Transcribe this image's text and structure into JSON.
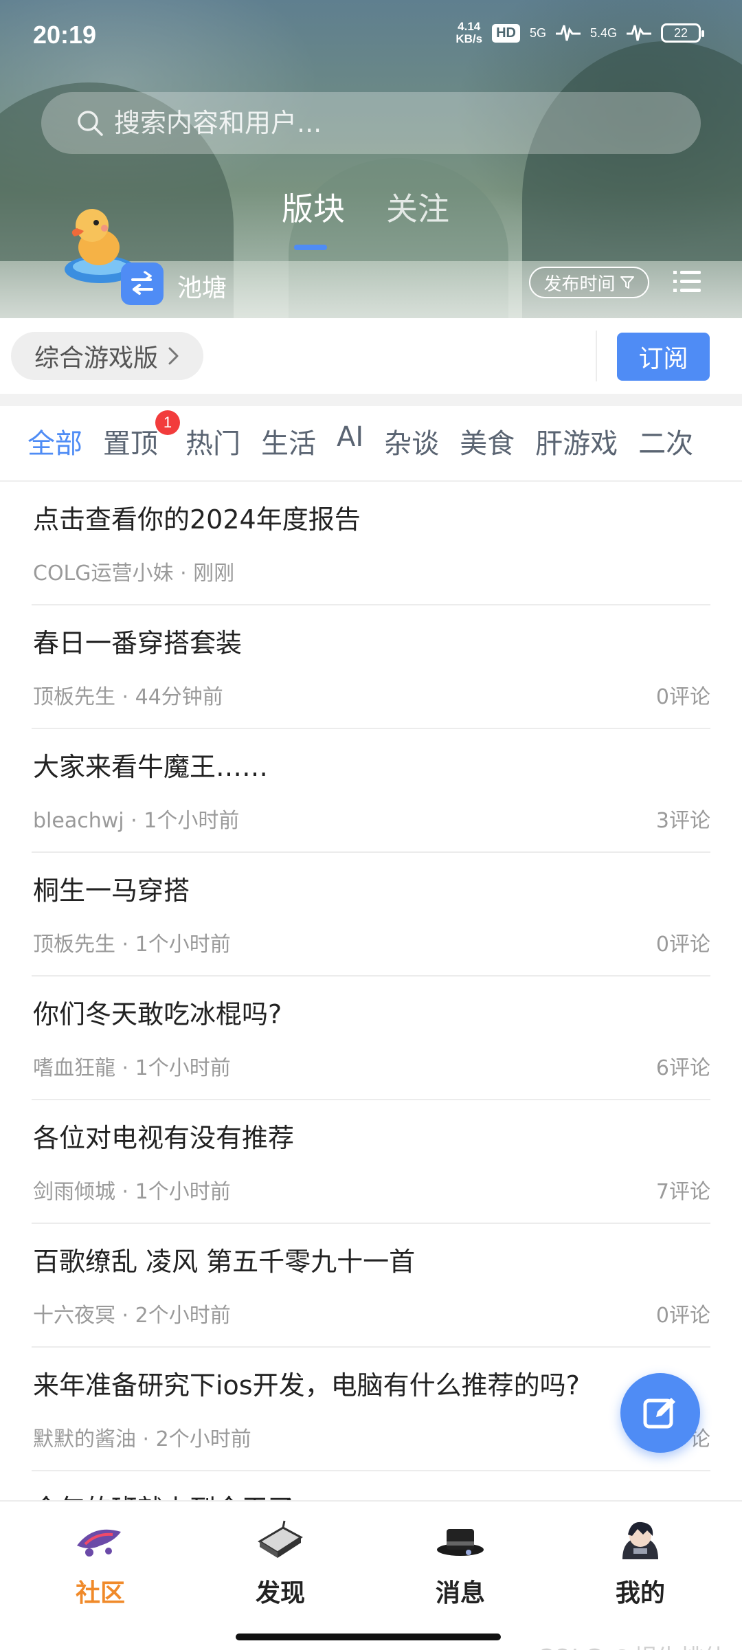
{
  "status_bar": {
    "time": "20:19",
    "net_speed_value": "4.14",
    "net_speed_unit": "KB/s",
    "hd_label": "HD",
    "signal1_label": "5G",
    "signal2_label": "5.4G",
    "battery": "22"
  },
  "search": {
    "placeholder": "搜索内容和用户..."
  },
  "main_tabs": [
    {
      "label": "版块",
      "active": true
    },
    {
      "label": "关注",
      "active": false
    }
  ],
  "pond": {
    "name": "池塘",
    "sort_label": "发布时间"
  },
  "forum": {
    "name": "综合游戏版",
    "subscribe_label": "订阅"
  },
  "category_tabs": [
    {
      "label": "全部",
      "active": true
    },
    {
      "label": "置顶",
      "badge": "1"
    },
    {
      "label": "热门"
    },
    {
      "label": "生活"
    },
    {
      "label": "AI"
    },
    {
      "label": "杂谈"
    },
    {
      "label": "美食"
    },
    {
      "label": "肝游戏"
    },
    {
      "label": "二次"
    }
  ],
  "posts": [
    {
      "title": "点击查看你的2024年度报告",
      "author": "COLG运营小妹",
      "time": "· 刚刚",
      "comments": ""
    },
    {
      "title": "春日一番穿搭套装",
      "author": "顶板先生",
      "time": "· 44分钟前",
      "comments": "0评论"
    },
    {
      "title": "大家来看牛魔王……",
      "author": "bleachwj",
      "time": "· 1个小时前",
      "comments": "3评论"
    },
    {
      "title": "桐生一马穿搭",
      "author": "顶板先生",
      "time": "· 1个小时前",
      "comments": "0评论"
    },
    {
      "title": "你们冬天敢吃冰棍吗?",
      "author": "嗜血狂龍",
      "time": "· 1个小时前",
      "comments": "6评论"
    },
    {
      "title": "各位对电视有没有推荐",
      "author": "剑雨倾城",
      "time": "· 1个小时前",
      "comments": "7评论"
    },
    {
      "title": "百歌缭乱 凌风 第五千零九十一首",
      "author": "十六夜冥",
      "time": "· 2个小时前",
      "comments": "0评论"
    },
    {
      "title": "来年准备研究下ios开发，电脑有什么推荐的吗?",
      "author": "默默的酱油",
      "time": "· 2个小时前",
      "comments": "论"
    },
    {
      "title": "今年的班就上到今天了",
      "author": "",
      "time": "",
      "comments": ""
    }
  ],
  "bottom_nav": [
    {
      "label": "社区",
      "active": true,
      "icon": "community-icon"
    },
    {
      "label": "发现",
      "active": false,
      "icon": "discover-icon"
    },
    {
      "label": "消息",
      "active": false,
      "icon": "message-icon"
    },
    {
      "label": "我的",
      "active": false,
      "icon": "profile-icon"
    }
  ],
  "watermark": "COLG @蜗牛桃仙",
  "colors": {
    "accent": "#4f8cf5",
    "nav_active": "#f08a2a",
    "badge": "#f23c3c"
  }
}
